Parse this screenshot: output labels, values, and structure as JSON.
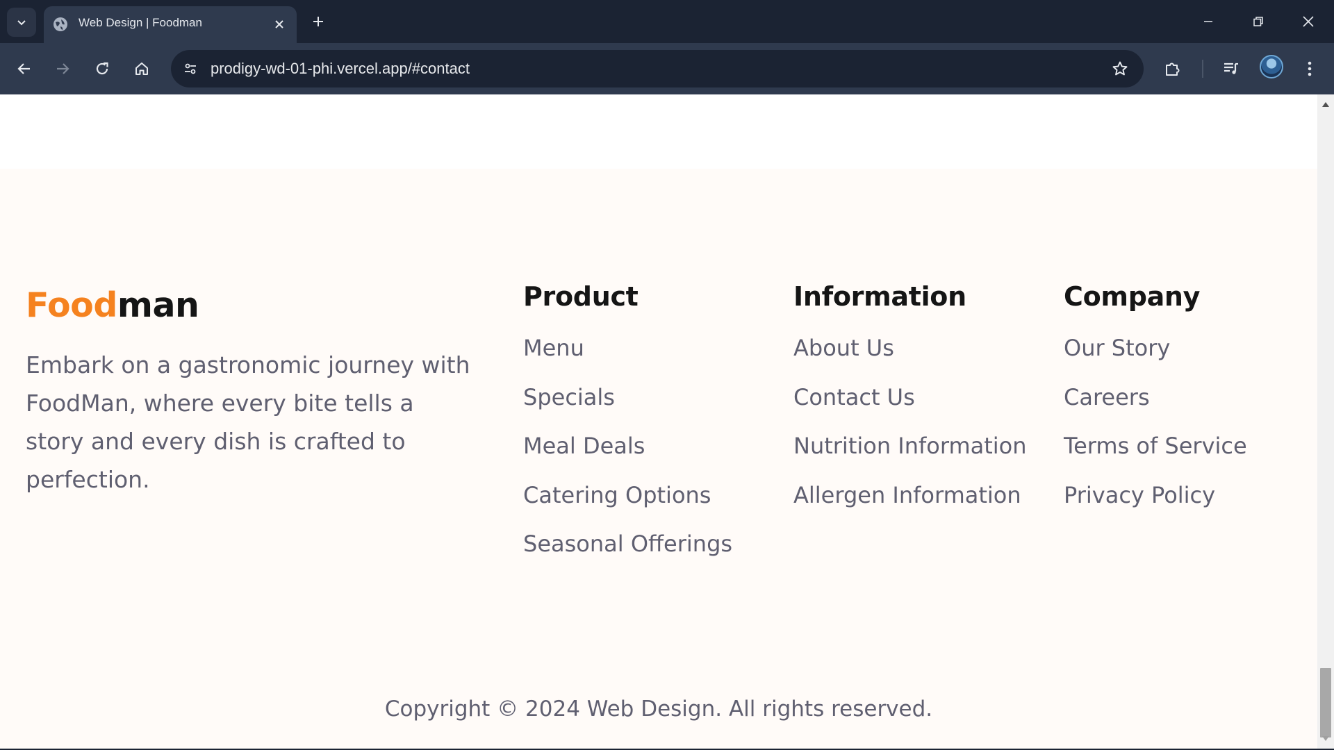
{
  "browser": {
    "tab": {
      "title": "Web Design | Foodman",
      "favicon": "globe-icon"
    },
    "address_bar": {
      "url": "prodigy-wd-01-phi.vercel.app/#contact"
    },
    "colors": {
      "chrome_dark": "#1b2333",
      "chrome_light": "#2f3a4e"
    }
  },
  "footer": {
    "brand": {
      "part1": "Food",
      "part2": "man",
      "accent_color": "#f5821f"
    },
    "tagline": "Embark on a gastronomic journey with FoodMan, where every bite tells a story and every dish is crafted to perfection.",
    "columns": [
      {
        "title": "Product",
        "links": [
          "Menu",
          "Specials",
          "Meal Deals",
          "Catering Options",
          "Seasonal Offerings"
        ]
      },
      {
        "title": "Information",
        "links": [
          "About Us",
          "Contact Us",
          "Nutrition Information",
          "Allergen Information"
        ]
      },
      {
        "title": "Company",
        "links": [
          "Our Story",
          "Careers",
          "Terms of Service",
          "Privacy Policy"
        ]
      }
    ],
    "copyright": "Copyright © 2024 Web Design. All rights reserved."
  }
}
